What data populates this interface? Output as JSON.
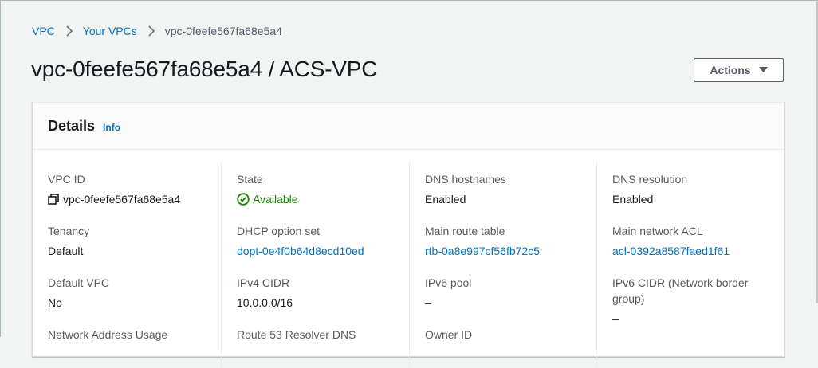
{
  "breadcrumb": {
    "items": [
      "VPC",
      "Your VPCs"
    ],
    "current": "vpc-0feefe567fa68e5a4"
  },
  "page": {
    "title": "vpc-0feefe567fa68e5a4 / ACS-VPC",
    "actions_label": "Actions"
  },
  "details": {
    "title": "Details",
    "info_label": "Info",
    "fields": {
      "vpc_id": {
        "label": "VPC ID",
        "value": "vpc-0feefe567fa68e5a4"
      },
      "state": {
        "label": "State",
        "value": "Available"
      },
      "dns_hostnames": {
        "label": "DNS hostnames",
        "value": "Enabled"
      },
      "dns_resolution": {
        "label": "DNS resolution",
        "value": "Enabled"
      },
      "tenancy": {
        "label": "Tenancy",
        "value": "Default"
      },
      "dhcp_option_set": {
        "label": "DHCP option set",
        "value": "dopt-0e4f0b64d8ecd10ed"
      },
      "main_route_table": {
        "label": "Main route table",
        "value": "rtb-0a8e997cf56fb72c5"
      },
      "main_network_acl": {
        "label": "Main network ACL",
        "value": "acl-0392a8587faed1f61"
      },
      "default_vpc": {
        "label": "Default VPC",
        "value": "No"
      },
      "ipv4_cidr": {
        "label": "IPv4 CIDR",
        "value": "10.0.0.0/16"
      },
      "ipv6_pool": {
        "label": "IPv6 pool",
        "value": "–"
      },
      "ipv6_cidr": {
        "label": "IPv6 CIDR (Network border group)",
        "value": "–"
      },
      "network_address_usage": {
        "label": "Network Address Usage"
      },
      "route53_resolver_dns": {
        "label": "Route 53 Resolver DNS"
      },
      "owner_id": {
        "label": "Owner ID"
      }
    }
  },
  "colors": {
    "link": "#0073bb",
    "success": "#1d8102",
    "text": "#16191f",
    "muted": "#545b64",
    "background": "#f2f3f3"
  }
}
